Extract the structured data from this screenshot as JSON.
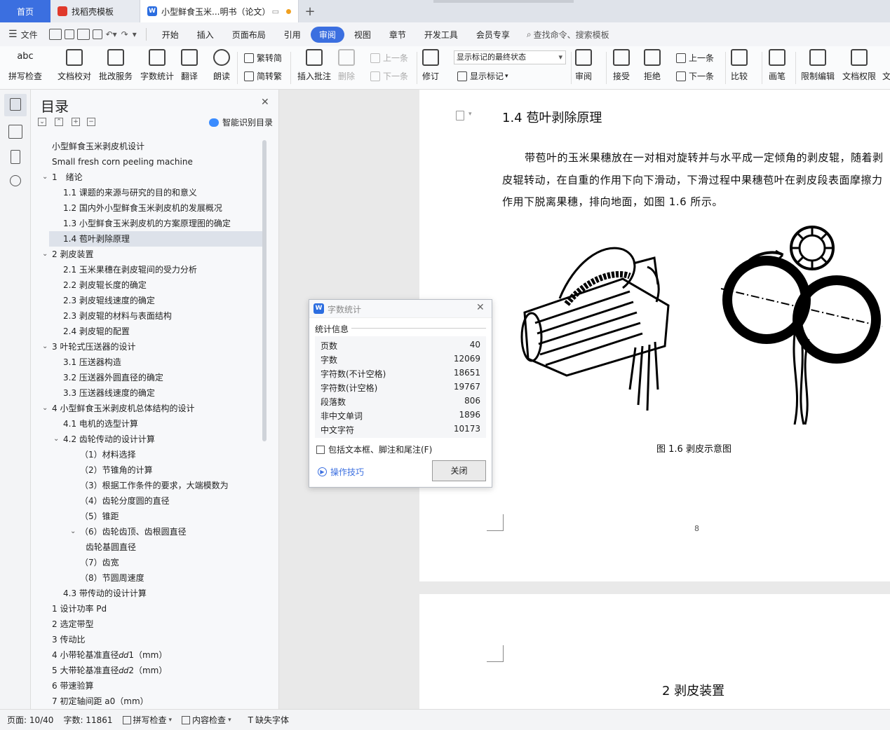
{
  "tabs": {
    "home": "首页",
    "templates": "找稻壳模板",
    "document": "小型鲜食玉米...明书（论文）",
    "add": "+"
  },
  "menu": {
    "file": "文件",
    "items": [
      "开始",
      "插入",
      "页面布局",
      "引用",
      "审阅",
      "视图",
      "章节",
      "开发工具",
      "会员专享"
    ],
    "active_index": 4,
    "search": "查找命令、搜索模板"
  },
  "ribbon": {
    "spell": "拼写检查",
    "spell_top": "abc",
    "proof": "文档校对",
    "annot_service": "批改服务",
    "word_count": "字数统计",
    "translate": "翻译",
    "read_aloud": "朗读",
    "trad": "繁转简",
    "simp": "简转繁",
    "insert_comment": "插入批注",
    "delete": "删除",
    "prev": "上一条",
    "next": "下一条",
    "revise": "修订",
    "markup_select": "显示标记的最终状态",
    "show_markup": "显示标记",
    "review": "审阅",
    "accept": "接受",
    "reject": "拒绝",
    "prev2": "上一条",
    "next2": "下一条",
    "compare": "比较",
    "pen": "画笔",
    "restrict": "限制编辑",
    "permission": "文档权限",
    "more": "文"
  },
  "toc": {
    "title": "目录",
    "smart": "智能识别目录",
    "items": [
      {
        "text": "小型鲜食玉米剥皮机设计",
        "indent": 0
      },
      {
        "text": "Small fresh corn peeling machine",
        "indent": 0
      },
      {
        "text": "1　绪论",
        "indent": 0,
        "arrow": true
      },
      {
        "text": "1.1  课题的来源与研究的目的和意义",
        "indent": 1
      },
      {
        "text": "1.2  国内外小型鲜食玉米剥皮机的发展概况",
        "indent": 1
      },
      {
        "text": "1.3  小型鲜食玉米剥皮机的方案原理图的确定",
        "indent": 1
      },
      {
        "text": "1.4  苞叶剥除原理",
        "indent": 1,
        "active": true
      },
      {
        "text": "2 剥皮装置",
        "indent": 0,
        "arrow": true
      },
      {
        "text": "2.1  玉米果穗在剥皮辊间的受力分析",
        "indent": 1
      },
      {
        "text": "2.2  剥皮辊长度的确定",
        "indent": 1
      },
      {
        "text": "2.3  剥皮辊线速度的确定",
        "indent": 1
      },
      {
        "text": "2.3  剥皮辊的材料与表面结构",
        "indent": 1
      },
      {
        "text": "2.4  剥皮辊的配置",
        "indent": 1
      },
      {
        "text": "3 叶轮式压送器的设计",
        "indent": 0,
        "arrow": true
      },
      {
        "text": "3.1  压送器构造",
        "indent": 1
      },
      {
        "text": "3.2  压送器外圆直径的确定",
        "indent": 1
      },
      {
        "text": "3.3  压送器线速度的确定",
        "indent": 1
      },
      {
        "text": "4 小型鲜食玉米剥皮机总体结构的设计",
        "indent": 0,
        "arrow": true
      },
      {
        "text": "4.1  电机的选型计算",
        "indent": 1
      },
      {
        "text": "4.2  齿轮传动的设计计算",
        "indent": 1,
        "arrow": true
      },
      {
        "text": "（1）材料选择",
        "indent": 2
      },
      {
        "text": "（2）节锥角的计算",
        "indent": 2
      },
      {
        "text": "（3）根据工作条件的要求，大端模数为",
        "indent": 2
      },
      {
        "text": "（4）齿轮分度圆的直径",
        "indent": 2
      },
      {
        "text": "（5）锥距",
        "indent": 2
      },
      {
        "text": "（6）齿轮齿顶、齿根圆直径",
        "indent": 2,
        "arrow": true
      },
      {
        "text": "齿轮基圆直径",
        "indent": 3
      },
      {
        "text": "（7）齿宽",
        "indent": 2
      },
      {
        "text": "（8）节圆周速度",
        "indent": 2
      },
      {
        "text": "4.3  带传动的设计计算",
        "indent": 1
      },
      {
        "text": "1 设计功率 Pd",
        "indent": 0
      },
      {
        "text": "2 选定带型",
        "indent": 0
      },
      {
        "text": "3  传动比",
        "indent": 0
      },
      {
        "text": "4  小带轮基准直径𝑑𝑑1（mm）",
        "indent": 0
      },
      {
        "text": "5  大带轮基准直径𝑑𝑑2（mm）",
        "indent": 0
      },
      {
        "text": "6  带速验算",
        "indent": 0
      },
      {
        "text": "7  初定轴间距 a0（mm）",
        "indent": 0
      }
    ]
  },
  "document": {
    "heading": "1.4  苞叶剥除原理",
    "para1": "带苞叶的玉米果穗放在一对相对旋转并与水平成一定倾角的剥皮辊，随着剥",
    "para2": "皮辊转动，在自重的作用下向下滑动，下滑过程中果穗苞叶在剥皮段表面摩擦力",
    "para3": "作用下脱离果穗，排向地面，如图 1.6 所示。",
    "caption": "图 1.6  剥皮示意图",
    "page_number": "8",
    "heading2": "2 剥皮装置"
  },
  "dialog": {
    "title": "字数统计",
    "section": "统计信息",
    "stats": [
      {
        "label": "页数",
        "value": "40"
      },
      {
        "label": "字数",
        "value": "12069"
      },
      {
        "label": "字符数(不计空格)",
        "value": "18651"
      },
      {
        "label": "字符数(计空格)",
        "value": "19767"
      },
      {
        "label": "段落数",
        "value": "806"
      },
      {
        "label": "非中文单词",
        "value": "1896"
      },
      {
        "label": "中文字符",
        "value": "10173"
      }
    ],
    "checkbox": "包括文本框、脚注和尾注(F)",
    "tips": "操作技巧",
    "close": "关闭"
  },
  "status": {
    "page": "页面: 10/40",
    "words": "字数: 11861",
    "spell": "拼写检查",
    "content": "内容检查",
    "fonts": "缺失字体"
  }
}
